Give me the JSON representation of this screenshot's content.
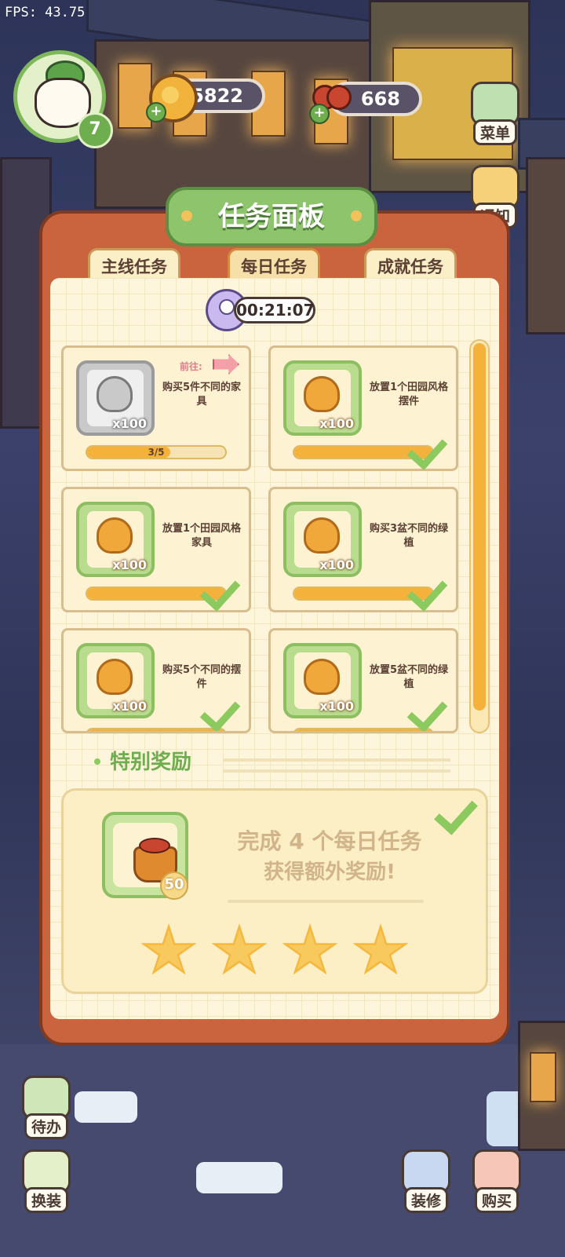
{
  "debug": {
    "fps": "FPS: 43.75"
  },
  "player": {
    "level": "7"
  },
  "currencies": {
    "coins": "5822",
    "cherries": "668"
  },
  "side_buttons": {
    "menu": "菜单",
    "notice": "通知",
    "todo": "待办",
    "dress": "换装",
    "decorate": "装修",
    "shop": "购买"
  },
  "panel": {
    "title": "任务面板",
    "tabs": [
      "主线任务",
      "每日任务",
      "成就任务"
    ],
    "active_tab": "每日任务",
    "timer": "00:21:07",
    "goto_label": "前往:",
    "tasks": [
      {
        "desc": "购买5件不同的家具",
        "reward_qty": "x100",
        "progress_text": "3/5",
        "progress": 0.6,
        "completed": false,
        "icon_state": "gray"
      },
      {
        "desc": "放置1个田园风格摆件",
        "reward_qty": "x100",
        "progress": 1.0,
        "completed": true
      },
      {
        "desc": "放置1个田园风格家具",
        "reward_qty": "x100",
        "progress": 1.0,
        "completed": true
      },
      {
        "desc": "购买3盆不同的绿植",
        "reward_qty": "x100",
        "progress": 1.0,
        "completed": true
      },
      {
        "desc": "购买5个不同的摆件",
        "reward_qty": "x100",
        "progress": 1.0,
        "completed": true
      },
      {
        "desc": "放置5盆不同的绿植",
        "reward_qty": "x100",
        "progress": 1.0,
        "completed": true
      }
    ],
    "special": {
      "title": "特别奖励",
      "line1": "完成 4 个每日任务",
      "line2": "获得额外奖励!",
      "reward_qty": "50",
      "stars_filled": 4,
      "stars_total": 4,
      "completed": true
    }
  },
  "colors": {
    "accent_green": "#8cc95e",
    "panel_frame": "#c9643f",
    "progress_orange": "#f4b23c"
  }
}
